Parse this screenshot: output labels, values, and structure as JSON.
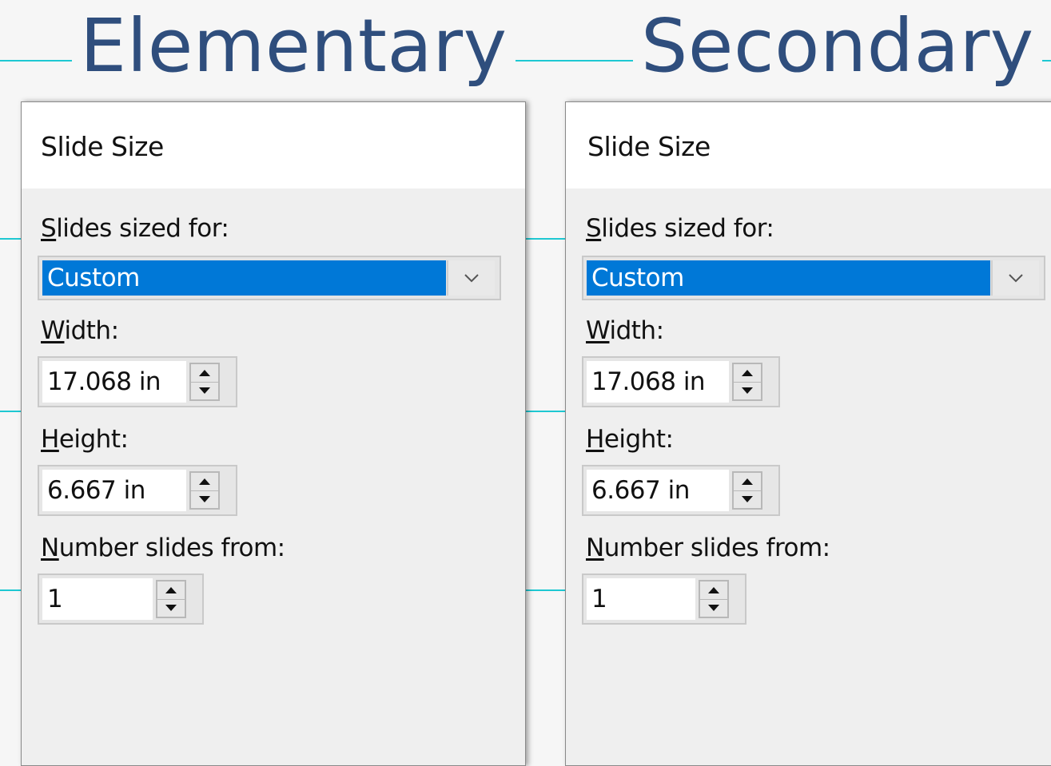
{
  "headings": {
    "left": "Elementary",
    "right": "Secondary"
  },
  "dialogs": [
    {
      "title": "Slide Size",
      "slides_sized_for": {
        "label_key": "S",
        "label_rest": "lides sized for:",
        "value": "Custom"
      },
      "width": {
        "label_key": "W",
        "label_rest": "idth:",
        "value": "17.068 in"
      },
      "height": {
        "label_key": "H",
        "label_rest": "eight:",
        "value": "6.667 in"
      },
      "number_from": {
        "label_key": "N",
        "label_rest": "umber slides from:",
        "value": "1"
      }
    },
    {
      "title": "Slide Size",
      "slides_sized_for": {
        "label_key": "S",
        "label_rest": "lides sized for:",
        "value": "Custom"
      },
      "width": {
        "label_key": "W",
        "label_rest": "idth:",
        "value": "17.068 in"
      },
      "height": {
        "label_key": "H",
        "label_rest": "eight:",
        "value": "6.667 in"
      },
      "number_from": {
        "label_key": "N",
        "label_rest": "umber slides from:",
        "value": "1"
      }
    }
  ],
  "colors": {
    "heading": "#2f4e7d",
    "guide_line": "#1ec8d2",
    "selection": "#0078d7"
  },
  "icons": {
    "dropdown": "chevron-down-icon",
    "spin_up": "triangle-up-icon",
    "spin_down": "triangle-down-icon"
  }
}
